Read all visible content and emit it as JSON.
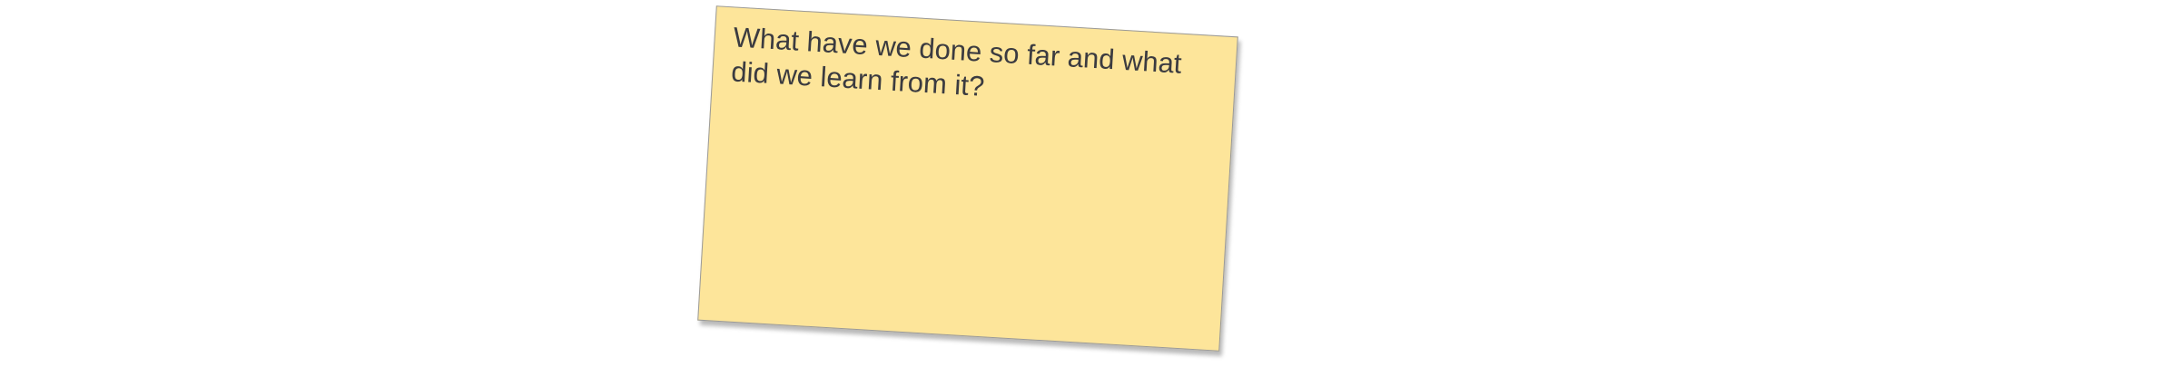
{
  "note": {
    "text": "What have we done so far and what did we learn from it?",
    "color": "#fde59a",
    "text_color": "#3b3b40"
  }
}
